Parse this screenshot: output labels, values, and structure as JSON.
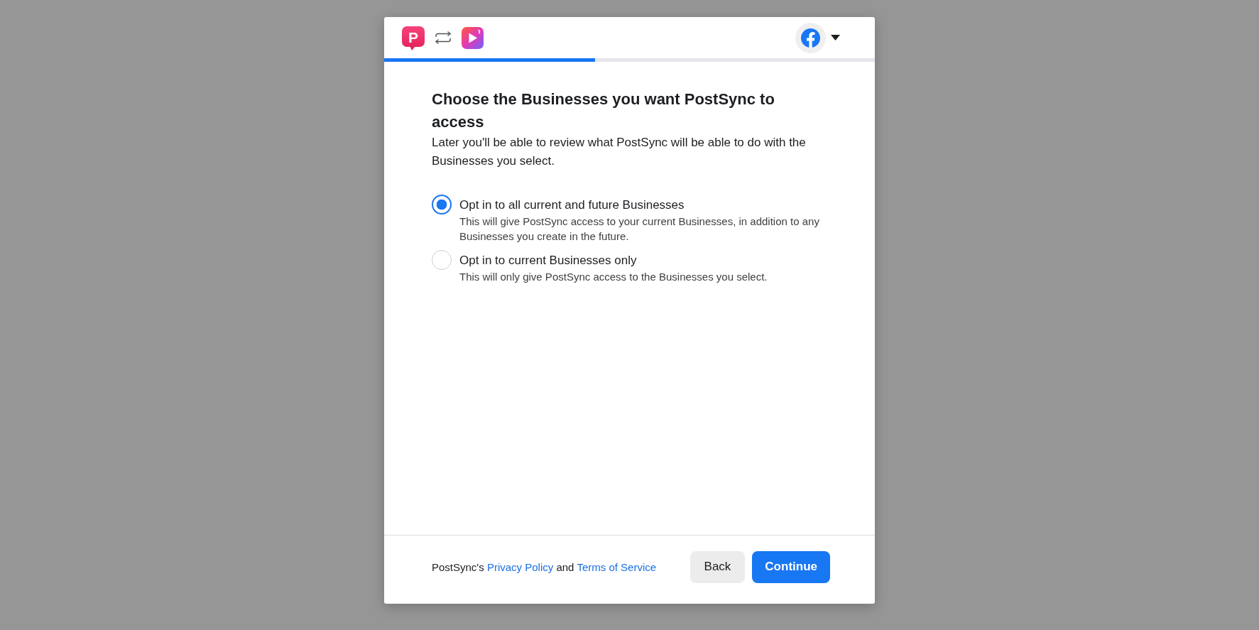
{
  "header": {
    "app_logo": {
      "letter": "P"
    },
    "progress": {
      "level": 0.43
    }
  },
  "title": "Choose the Businesses you want PostSync to access",
  "description": "Later you'll be able to review what PostSync will be able to do with the Businesses you select.",
  "options": [
    {
      "label": "Opt in to all current and future Businesses",
      "description": "This will give PostSync access to your current Businesses, in addition to any Businesses you create in the future.",
      "selected": true
    },
    {
      "label": "Opt in to current Businesses only",
      "description": "This will only give PostSync access to the Businesses you select.",
      "selected": false
    }
  ],
  "footer": {
    "legal": [
      {
        "kind": "text",
        "text": "PostSync's"
      },
      {
        "kind": "link",
        "text": "Privacy Policy"
      },
      {
        "kind": "text",
        "text": "and"
      },
      {
        "kind": "link",
        "text": "Terms of Service"
      }
    ],
    "buttons": [
      {
        "label": "Back",
        "kind": "secondary"
      },
      {
        "label": "Continue",
        "kind": "primary"
      }
    ]
  }
}
